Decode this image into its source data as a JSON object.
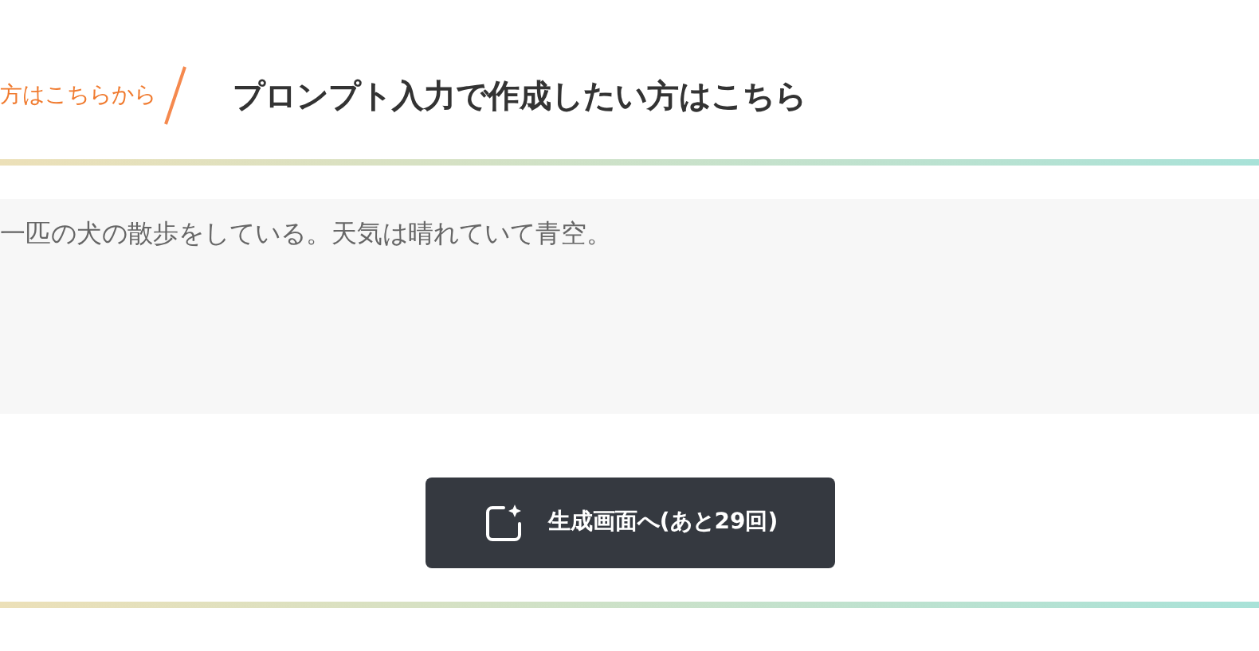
{
  "tabs": [
    {
      "label": "方はこちらから",
      "selected": false
    },
    {
      "label": "プロンプト入力で作成したい方はこちら",
      "selected": true
    }
  ],
  "prompt": {
    "value": "一匹の犬の散歩をしている。天気は晴れていて青空。"
  },
  "generate_button": {
    "label": "生成画面へ(あと29回)"
  }
}
